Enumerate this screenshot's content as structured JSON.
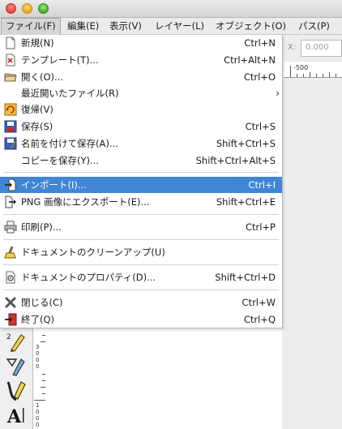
{
  "menubar": {
    "items": [
      {
        "label": "ファイル(F)",
        "active": true
      },
      {
        "label": "編集(E)"
      },
      {
        "label": "表示(V)"
      },
      {
        "label": "レイヤー(L)"
      },
      {
        "label": "オブジェクト(O)"
      },
      {
        "label": "パス(P)"
      }
    ]
  },
  "toolbar": {
    "x_label": "X:",
    "x_value": "0.000",
    "ruler_label": "-500"
  },
  "vruler_digits": [
    "3",
    "0",
    "0",
    "0",
    "1",
    "0",
    "0",
    "0"
  ],
  "file_menu": {
    "items": [
      {
        "label": "新規(N)",
        "shortcut": "Ctrl+N",
        "icon": "new-document-icon"
      },
      {
        "label": "テンプレート(T)...",
        "shortcut": "Ctrl+Alt+N",
        "icon": "template-icon"
      },
      {
        "label": "開く(O)...",
        "shortcut": "Ctrl+O",
        "icon": "open-folder-icon"
      },
      {
        "label": "最近開いたファイル(R)",
        "shortcut": "",
        "icon": "",
        "submenu": true
      },
      {
        "label": "復帰(V)",
        "shortcut": "",
        "icon": "revert-icon"
      },
      {
        "label": "保存(S)",
        "shortcut": "Ctrl+S",
        "icon": "save-icon"
      },
      {
        "label": "名前を付けて保存(A)...",
        "shortcut": "Shift+Ctrl+S",
        "icon": "save-as-icon"
      },
      {
        "label": "コピーを保存(Y)...",
        "shortcut": "Shift+Ctrl+Alt+S",
        "icon": ""
      },
      {
        "label": "インポート(I)...",
        "shortcut": "Ctrl+I",
        "icon": "import-icon",
        "highlighted": true
      },
      {
        "label": "PNG 画像にエクスポート(E)...",
        "shortcut": "Shift+Ctrl+E",
        "icon": "export-icon"
      },
      {
        "label": "印刷(P)...",
        "shortcut": "Ctrl+P",
        "icon": "print-icon"
      },
      {
        "label": "ドキュメントのクリーンアップ(U)",
        "shortcut": "",
        "icon": "cleanup-icon"
      },
      {
        "label": "ドキュメントのプロパティ(D)...",
        "shortcut": "Shift+Ctrl+D",
        "icon": "properties-icon"
      },
      {
        "label": "閉じる(C)",
        "shortcut": "Ctrl+W",
        "icon": "close-icon"
      },
      {
        "label": "終了(Q)",
        "shortcut": "Ctrl+Q",
        "icon": "quit-icon"
      }
    ],
    "submenu_arrow": "›"
  },
  "colors": {
    "highlight": "#3f86d6",
    "menubar_bg": "#ebebeb"
  }
}
